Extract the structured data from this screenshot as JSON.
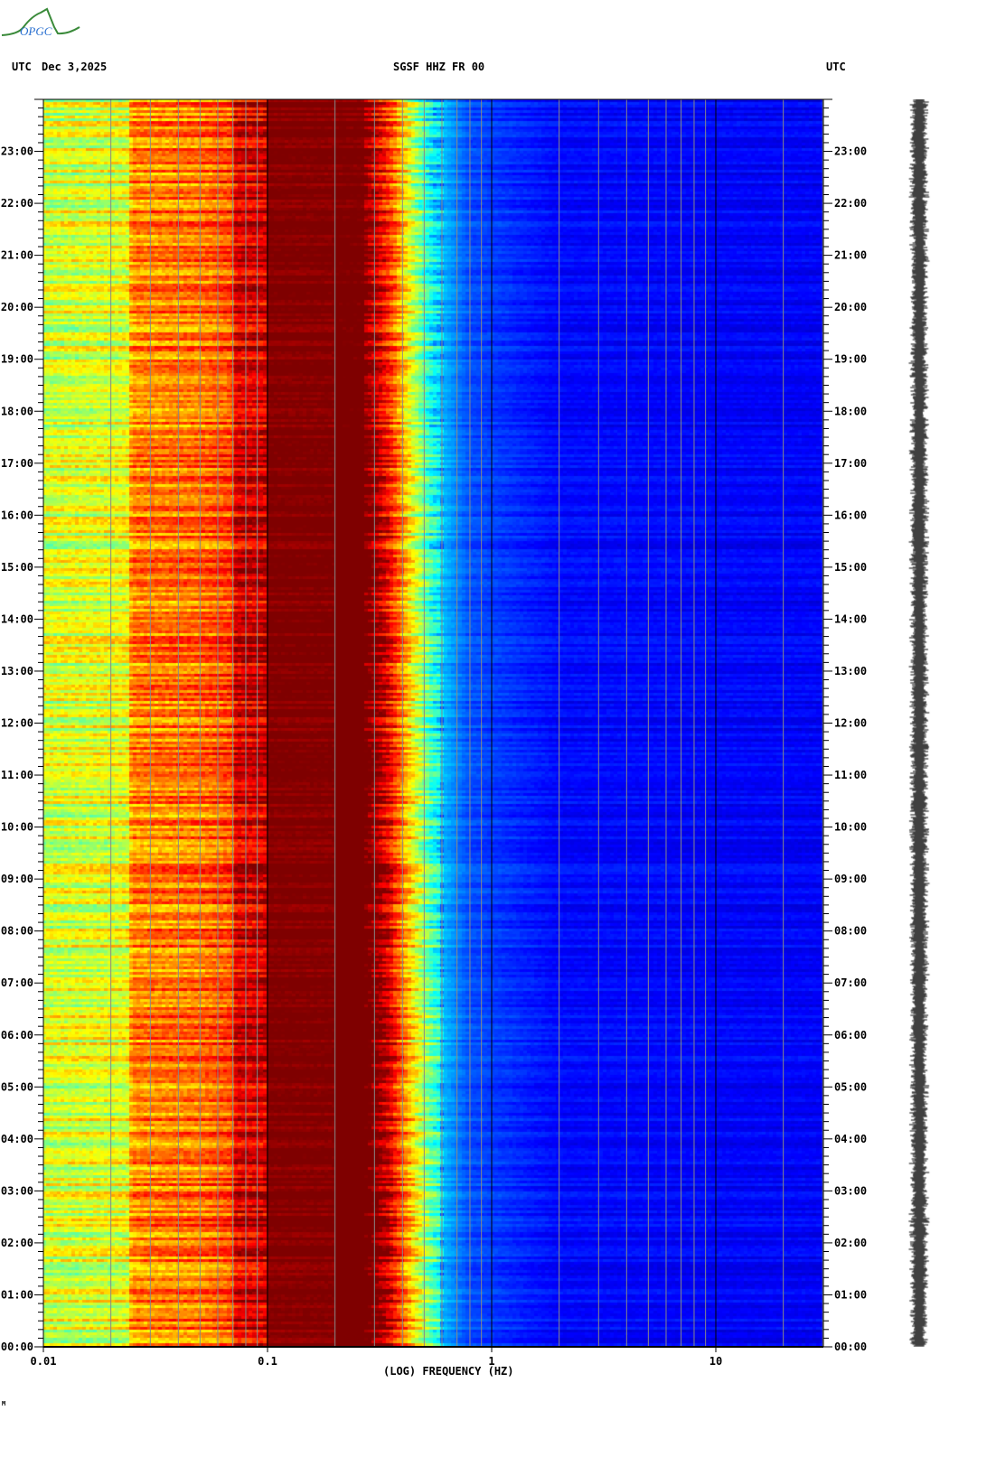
{
  "header": {
    "tz_left": "UTC",
    "date": "Dec 3,2025",
    "station": "SGSF HHZ FR 00",
    "tz_right": "UTC"
  },
  "logo": {
    "text": "OPGC"
  },
  "footer_mark": "M",
  "colors": {
    "low": "#0000c0",
    "high": "#800000"
  },
  "chart_data": {
    "type": "heatmap",
    "title": "SGSF HHZ FR 00",
    "xlabel": "(LOG) FREQUENCY (HZ)",
    "ylabel": "UTC",
    "xscale": "log",
    "xlim": [
      0.01,
      30
    ],
    "ylim_hours": [
      0,
      24
    ],
    "x_ticks": [
      {
        "v": 0.01,
        "label": "0.01"
      },
      {
        "v": 0.1,
        "label": "0.1"
      },
      {
        "v": 1,
        "label": "1"
      },
      {
        "v": 10,
        "label": "10"
      }
    ],
    "y_ticks": [
      "00:00",
      "01:00",
      "02:00",
      "03:00",
      "04:00",
      "05:00",
      "06:00",
      "07:00",
      "08:00",
      "09:00",
      "10:00",
      "11:00",
      "12:00",
      "13:00",
      "14:00",
      "15:00",
      "16:00",
      "17:00",
      "18:00",
      "19:00",
      "20:00",
      "21:00",
      "22:00",
      "23:00"
    ],
    "colormap": "jet",
    "relative_power_profile": [
      {
        "f": 0.01,
        "p": 0.58
      },
      {
        "f": 0.024,
        "p": 0.6
      },
      {
        "f": 0.025,
        "p": 0.74
      },
      {
        "f": 0.05,
        "p": 0.76
      },
      {
        "f": 0.07,
        "p": 0.8
      },
      {
        "f": 0.072,
        "p": 0.9
      },
      {
        "f": 0.1,
        "p": 0.92
      },
      {
        "f": 0.101,
        "p": 1.0
      },
      {
        "f": 0.27,
        "p": 1.0
      },
      {
        "f": 0.35,
        "p": 0.82
      },
      {
        "f": 0.45,
        "p": 0.55
      },
      {
        "f": 0.55,
        "p": 0.35
      },
      {
        "f": 0.8,
        "p": 0.2
      },
      {
        "f": 2,
        "p": 0.13
      },
      {
        "f": 30,
        "p": 0.12
      }
    ]
  }
}
